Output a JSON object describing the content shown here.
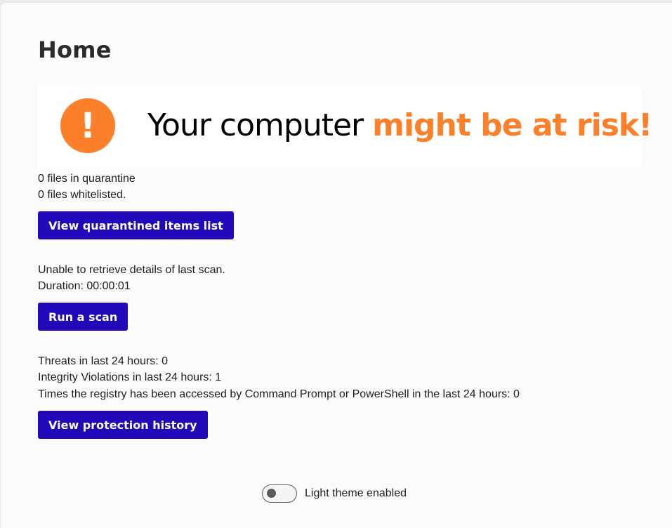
{
  "page": {
    "title": "Home"
  },
  "banner": {
    "icon": "exclamation-icon",
    "icon_glyph": "!",
    "text_prefix": "Your computer ",
    "text_emphasis": "might be at risk!",
    "accent_color": "#fc7f2a"
  },
  "quarantine": {
    "files_quarantine": "0 files in quarantine",
    "files_whitelisted": "0 files whitelisted.",
    "button_label": "View quarantined items list"
  },
  "scan": {
    "status": "Unable to retrieve details of last scan.",
    "duration": "Duration: 00:00:01",
    "button_label": "Run a scan"
  },
  "protection": {
    "threats": "Threats in last 24 hours: 0",
    "integrity": "Integrity Violations in last 24 hours: 1",
    "registry": "Times the registry has been accessed by Command Prompt or PowerShell in the last 24 hours: 0",
    "button_label": "View protection history"
  },
  "theme": {
    "toggle_label": "Light theme enabled",
    "toggle_on": false
  },
  "colors": {
    "button": "#2108b8",
    "warning": "#fc7f2a"
  }
}
